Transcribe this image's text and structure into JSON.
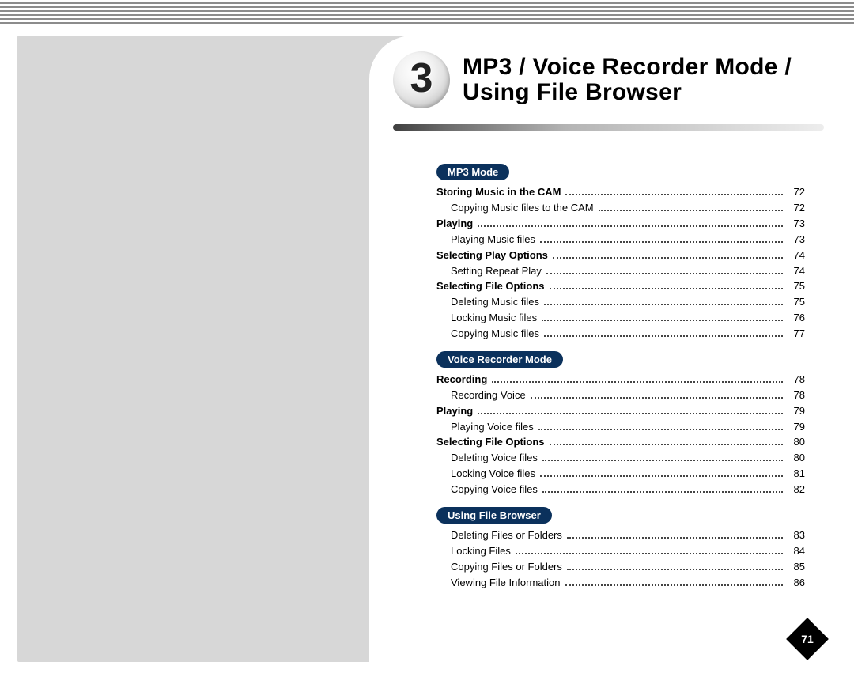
{
  "chapter": {
    "number": "3",
    "title_line1": "MP3 / Voice Recorder Mode /",
    "title_line2": "Using File Browser"
  },
  "pageNumber": "71",
  "sections": [
    {
      "heading": "MP3 Mode",
      "entries": [
        {
          "label": "Storing Music in the CAM",
          "page": "72",
          "bold": true,
          "indent": false
        },
        {
          "label": "Copying Music files to the CAM",
          "page": "72",
          "bold": false,
          "indent": true
        },
        {
          "label": "Playing",
          "page": "73",
          "bold": true,
          "indent": false
        },
        {
          "label": "Playing Music files",
          "page": "73",
          "bold": false,
          "indent": true
        },
        {
          "label": "Selecting Play Options",
          "page": "74",
          "bold": true,
          "indent": false
        },
        {
          "label": "Setting Repeat Play",
          "page": "74",
          "bold": false,
          "indent": true
        },
        {
          "label": "Selecting File Options",
          "page": "75",
          "bold": true,
          "indent": false
        },
        {
          "label": "Deleting Music files",
          "page": "75",
          "bold": false,
          "indent": true
        },
        {
          "label": "Locking Music files",
          "page": "76",
          "bold": false,
          "indent": true
        },
        {
          "label": "Copying Music files",
          "page": "77",
          "bold": false,
          "indent": true
        }
      ]
    },
    {
      "heading": "Voice Recorder Mode",
      "entries": [
        {
          "label": "Recording",
          "page": "78",
          "bold": true,
          "indent": false
        },
        {
          "label": "Recording Voice",
          "page": "78",
          "bold": false,
          "indent": true
        },
        {
          "label": "Playing",
          "page": "79",
          "bold": true,
          "indent": false
        },
        {
          "label": "Playing Voice files",
          "page": "79",
          "bold": false,
          "indent": true
        },
        {
          "label": "Selecting File Options",
          "page": "80",
          "bold": true,
          "indent": false
        },
        {
          "label": "Deleting Voice files",
          "page": "80",
          "bold": false,
          "indent": true
        },
        {
          "label": "Locking Voice files",
          "page": "81",
          "bold": false,
          "indent": true
        },
        {
          "label": "Copying Voice files",
          "page": "82",
          "bold": false,
          "indent": true
        }
      ]
    },
    {
      "heading": "Using File Browser",
      "entries": [
        {
          "label": "Deleting Files or Folders",
          "page": "83",
          "bold": false,
          "indent": true
        },
        {
          "label": "Locking Files",
          "page": "84",
          "bold": false,
          "indent": true
        },
        {
          "label": "Copying Files or Folders",
          "page": "85",
          "bold": false,
          "indent": true
        },
        {
          "label": "Viewing File Information",
          "page": "86",
          "bold": false,
          "indent": true
        }
      ]
    }
  ]
}
